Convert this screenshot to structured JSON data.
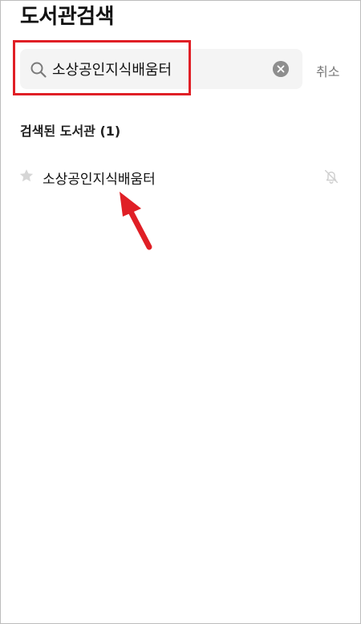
{
  "header": {
    "title": "도서관검색"
  },
  "search": {
    "value": "소상공인지식배움터",
    "cancel_label": "취소"
  },
  "results": {
    "heading": "검색된 도서관 (1)",
    "items": [
      {
        "label": "소상공인지식배움터"
      }
    ]
  },
  "icons": {
    "search": "search-icon",
    "clear": "clear-icon",
    "star": "star-icon",
    "notification": "bell-off-icon"
  },
  "colors": {
    "annotation": "#e01f26",
    "muted": "#777777",
    "input_bg": "#f4f4f4"
  }
}
